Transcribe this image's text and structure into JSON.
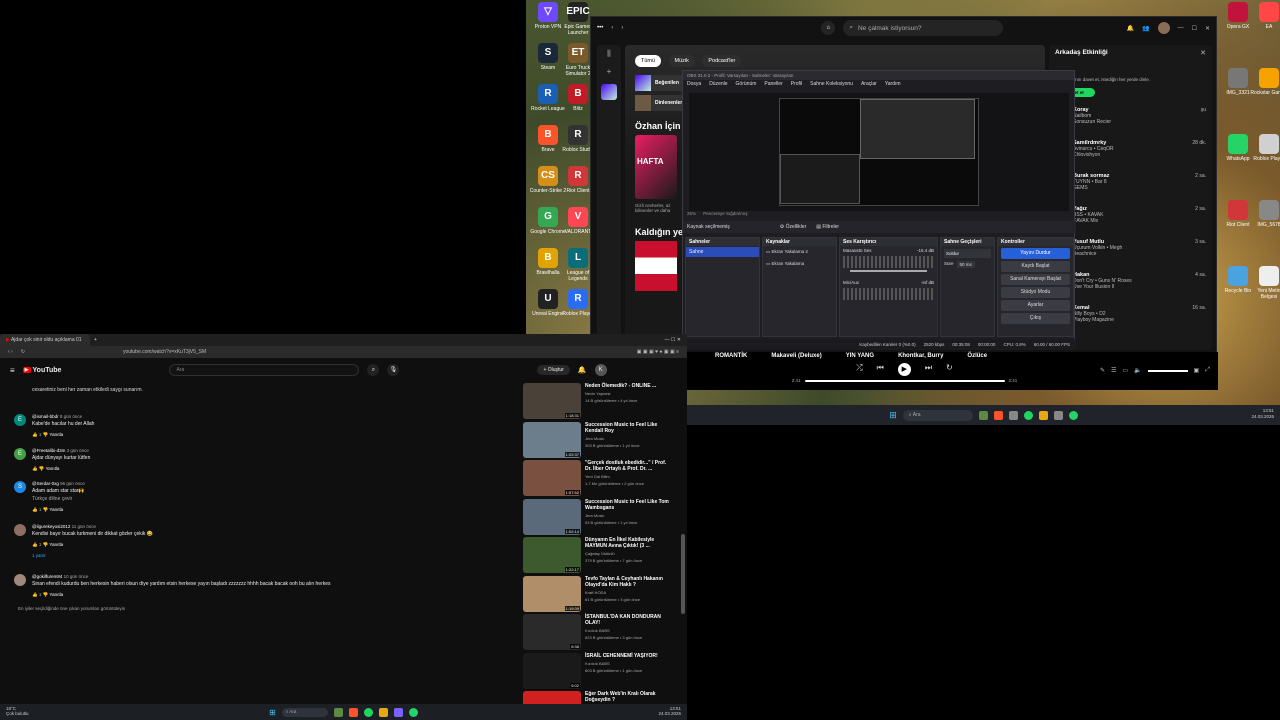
{
  "desktop": {
    "icons": [
      {
        "label": "Proton VPN",
        "glyph": "▽",
        "color": "#6d4aff"
      },
      {
        "label": "Epic Games Launcher",
        "glyph": "EPIC",
        "color": "#222"
      },
      {
        "label": "Steam",
        "glyph": "S",
        "color": "#1b2838"
      },
      {
        "label": "Euro Truck Simulator 2",
        "glyph": "ET",
        "color": "#7a5a2a"
      },
      {
        "label": "Rocket League",
        "glyph": "R",
        "color": "#1a5fb4"
      },
      {
        "label": "Blitz",
        "glyph": "B",
        "color": "#c01c28"
      },
      {
        "label": "Brave",
        "glyph": "B",
        "color": "#fb542b"
      },
      {
        "label": "Roblox Studio",
        "glyph": "R",
        "color": "#333"
      },
      {
        "label": "Counter-Strike 2",
        "glyph": "CS",
        "color": "#d58e1a"
      },
      {
        "label": "Riot Client",
        "glyph": "R",
        "color": "#d13639"
      },
      {
        "label": "Google Chrome",
        "glyph": "G",
        "color": "#34a853"
      },
      {
        "label": "VALORANT",
        "glyph": "V",
        "color": "#ff4655"
      },
      {
        "label": "Brawlhalla",
        "glyph": "B",
        "color": "#e0a300"
      },
      {
        "label": "League of Legends",
        "glyph": "L",
        "color": "#0a6e7a"
      },
      {
        "label": "Unreal Engine",
        "glyph": "U",
        "color": "#222"
      },
      {
        "label": "Roblox Player",
        "glyph": "R",
        "color": "#2a6cf5"
      }
    ],
    "right_icons": [
      {
        "label": "Opera GX",
        "color": "#c0143c"
      },
      {
        "label": "EA",
        "color": "#ff4747"
      },
      {
        "label": "IMG_3321",
        "color": "#777"
      },
      {
        "label": "Rockstar Games",
        "color": "#f4a300"
      },
      {
        "label": "WhatsApp",
        "color": "#25d366"
      },
      {
        "label": "Roblox Player",
        "color": "#d0d0d0"
      },
      {
        "label": "Riot Client",
        "color": "#d13639"
      },
      {
        "label": "IMG_5678",
        "color": "#888"
      },
      {
        "label": "Recycle Bin",
        "color": "#4aa3df"
      },
      {
        "label": "Yeni Metin Belgesi",
        "color": "#eee"
      }
    ]
  },
  "spotify": {
    "search_placeholder": "Ne çalmak istiyorsun?",
    "filters": [
      "Tümü",
      "Müzik",
      "Podcast'ler"
    ],
    "main_heading": "Özhan İçin",
    "made_heading": "Kaldığın yerden",
    "hafta_card": "HAFTA",
    "hafta_desc": "Gizli cevherler, az bilinenler ve daha",
    "recent": [
      "Beğenilen",
      "Dinlenenler"
    ],
    "friend_title": "Arkadaş Etkinliği",
    "friend_intro": "Arkadaşlarını davet et, istediğin her yerde dinle.",
    "friend_button": "Davet et",
    "friends": [
      {
        "name": "Koray",
        "track": "Nailbom",
        "artist": "Sonsuzun Recier",
        "time": "şu"
      },
      {
        "name": "Samilrdmrky",
        "track": "Avinurcu • CeqOR",
        "artist": "Chlovishyon",
        "time": "28 dk."
      },
      {
        "name": "Burak sormaz",
        "track": "TUYNN • Bar 8",
        "artist": "GEMS",
        "time": "2 sa."
      },
      {
        "name": "Yağız",
        "track": "BSS • KAVAK",
        "artist": "KAVAK Mix",
        "time": "2 sa."
      },
      {
        "name": "Yusuf Mutlu",
        "track": "Uçurum Volkin • Megh",
        "artist": "Beachnice",
        "time": "3 sa."
      },
      {
        "name": "Hakan",
        "track": "Don't Cry • Guns N' Roses",
        "artist": "Use Your Illusion II",
        "time": "4 sa."
      },
      {
        "name": "Kemal",
        "track": "Billy Boys • D2",
        "artist": "Playboy Magazine",
        "time": "16 sa."
      }
    ],
    "player": {
      "tracks_row": [
        "ROMANTİK",
        "Makaveli (Deluxe)",
        "YIN YANG",
        "Khontkar, Burry",
        "Özlüce"
      ],
      "time_elapsed": "2:41",
      "time_total": "2:41"
    }
  },
  "obs": {
    "title": "OBS 31.0.2 - Profil: Varsayılan - Sahneler: Varsayılan",
    "menu": [
      "Dosya",
      "Düzenle",
      "Görünüm",
      "Paneller",
      "Profil",
      "Sahne Koleksiyonu",
      "Araçlar",
      "Yardım"
    ],
    "source_label": "Kaynak seçilmemiş",
    "props_btn": "Özellikler",
    "filters_btn": "Filtreler",
    "preview_zoom": "25%",
    "preview_label": "Pencereye Sığdırılmış",
    "docks": {
      "scenes": {
        "title": "Sahneler",
        "items": [
          "Sahne"
        ]
      },
      "sources": {
        "title": "Kaynaklar",
        "items": [
          "Ekran Yakalama 2",
          "Ekran Yakalama"
        ]
      },
      "mixer": {
        "title": "Ses Karıştırıcı",
        "channels": [
          {
            "name": "Masaüstü Ses",
            "db": "-15.4 dB"
          },
          {
            "name": "Mic/Aux",
            "db": "-inf dB"
          }
        ]
      },
      "transitions": {
        "title": "Sahne Geçişleri",
        "mode": "Soldur",
        "duration_label": "Süre",
        "duration": "50 ms"
      },
      "controls": {
        "title": "Kontroller",
        "buttons": [
          "Yayını Durdur",
          "Kaydı Başlat",
          "Sanal Kamerayı Başlat",
          "Stüdyo Modu",
          "Ayarlar",
          "Çıkış"
        ]
      }
    },
    "status": {
      "dropped": "Kaybedilen Kareler 0 (%0.0)",
      "bitrate": "2520 kbps",
      "live": "00:35:08",
      "rec": "00:00:00",
      "cpu": "CPU: 0.8%",
      "fps": "60.00 / 60.00 FPS"
    }
  },
  "browser": {
    "tab_title": "Ajdar çok sinir oldu açıklama 01",
    "url": "youtube.com/watch?v=xKuT3jV5_SM",
    "youtube": {
      "logo": "YouTube",
      "search_placeholder": "Ara",
      "create_label": "Oluştur",
      "avatar": "K",
      "top_comment_text": "cesaretiniz beni her zaman etkiledi saygı sunarım.",
      "comments": [
        {
          "avatar": "E",
          "color": "#00897b",
          "author": "@ismail-bbdr",
          "age": "8 gün önce",
          "text": "Kabe'de hacılar hu der Allah",
          "likes": "1"
        },
        {
          "avatar": "E",
          "color": "#43a047",
          "author": "@Freetalibi-d3m",
          "age": "3 gün önce",
          "text": "Ajdar dünyayı kurtar lütfen",
          "likes": ""
        },
        {
          "avatar": "S",
          "color": "#1e88e5",
          "author": "@Serdar-0xg",
          "age": "96 gün önce",
          "text": "Adam adam star star🙌",
          "extra": "Türkçe diline çevir",
          "likes": "1"
        },
        {
          "avatar": "",
          "color": "#8d6e63",
          "author": "@ilgurekeyosi2012",
          "age": "11 gün önce",
          "text": "Kendisi bayır bucak turkmeni dir dikkat gözler çekik 😂",
          "likes": "1",
          "replies": "1 yanıt"
        },
        {
          "avatar": "",
          "color": "#a1887f",
          "author": "@gokilfurem84",
          "age": "10 gün önce",
          "text": "Sinan efendi kudurdu ben herkesin haberi olsun diye yardım etsin herkese yayın başladı zzzzzzz hhhh bacak bacak ooh bu alın herkes",
          "likes": "1"
        }
      ],
      "footer_note": "En iyiler seçildiğinde öne çıkan yorumları görüntüleyin",
      "reply_label": "Yanıtla",
      "recs": [
        {
          "title": "Neden Ölemedik? - ONLINE ...",
          "channel": "Nevin Yapnesi",
          "meta": "14 B görüntüleme • 4 yıl önce",
          "thumb": "#4a4238",
          "dur": "1:18:31"
        },
        {
          "title": "Succession Music to Feel Like Kendall Roy",
          "channel": "Jera Music",
          "meta": "303 B görüntüleme • 1 yıl önce",
          "thumb": "#6c7d8c",
          "dur": "1:02:37"
        },
        {
          "title": "\"Gerçek dostluk ebedidir...\" / Prof. Dr. İlber Ortaylı & Prof. Dr. ...",
          "channel": "Yeni Gal Bilim",
          "meta": "1.7 Mn görüntüleme • 2 gün önce",
          "thumb": "#7a5040",
          "dur": "1:57:52"
        },
        {
          "title": "Succession Music to Feel Like Tom Wambsgans",
          "channel": "Jera Music",
          "meta": "53 B görüntüleme • 1 yıl önce",
          "thumb": "#5a6a7a",
          "dur": "1:02:14"
        },
        {
          "title": "Dünyanın En İlkel Kabilesiyle MAYMUN Avına Çıktık! (3 ...",
          "channel": "Çağatay Üstünlü",
          "meta": "379 B görüntüleme • 7 gün önce",
          "thumb": "#3d5a2e",
          "dur": "1:22:17"
        },
        {
          "title": "Tevfo Taylan & Ceyhanlı Hakanın Olayıd'da Kim Haklı ?",
          "channel": "Kraft HODA",
          "meta": "61 B görüntüleme • 3 gün önce",
          "thumb": "#b08e6a",
          "dur": "1:19:39"
        },
        {
          "title": "İSTANBUL'DA KAN DONDURAN OLAY!",
          "channel": "Kızılcık BABS",
          "meta": "823 B görüntüleme • 3 gün önce",
          "thumb": "#2a2a2a",
          "dur": "6:38"
        },
        {
          "title": "İSRAİL CEHENNEMİ YAŞIYOR!",
          "channel": "Kızılcık BABS",
          "meta": "603 B görüntüleme • 1 gün önce",
          "thumb": "#1a1a1a",
          "dur": "6:02"
        },
        {
          "title": "Eğer Dark Web'in Kralı Olarak Doğseydin ?",
          "channel": "Logout",
          "meta": "16 B görüntüleme • 2 gün önce",
          "thumb": "#d02020",
          "dur": "12:40"
        }
      ]
    }
  },
  "taskbar": {
    "weather": "18°C",
    "weather_desc": "Çok bulutlu",
    "search": "Ara",
    "time_left": "13:51",
    "date_left": "24.03.2026",
    "time_right": "13:51",
    "date_right": "24.03.2026"
  }
}
